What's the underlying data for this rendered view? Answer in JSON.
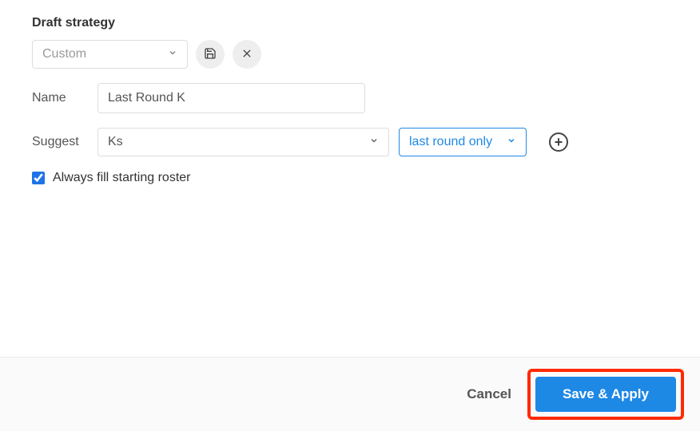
{
  "title": "Draft strategy",
  "strategy": {
    "selected": "Custom"
  },
  "name": {
    "label": "Name",
    "value": "Last Round K"
  },
  "suggest": {
    "label": "Suggest",
    "selected": "Ks",
    "timing": "last round only"
  },
  "checkbox": {
    "label": "Always fill starting roster",
    "checked": true
  },
  "footer": {
    "cancel": "Cancel",
    "save": "Save & Apply"
  }
}
